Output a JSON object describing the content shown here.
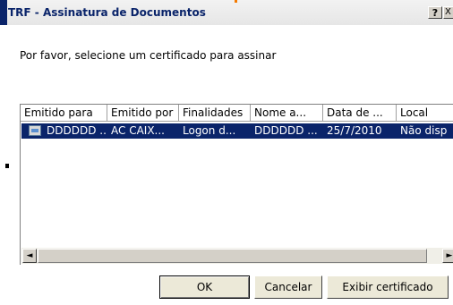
{
  "window": {
    "title": "TRF - Assinatura de Documentos",
    "help_label": "?",
    "close_label": "X"
  },
  "prompt": "Por favor, selecione um certificado para assinar",
  "table": {
    "columns": [
      "Emitido para",
      "Emitido por",
      "Finalidades",
      "Nome a...",
      "Data de ...",
      "Local"
    ],
    "rows": [
      {
        "icon": "certificate-icon",
        "cells": [
          "DDDDDD ..",
          "AC CAIX...",
          "Logon d...",
          "DDDDDD ...",
          "25/7/2010",
          "Não disp"
        ],
        "selected": true
      }
    ]
  },
  "scrollbar": {
    "left_arrow": "◄",
    "right_arrow": "►"
  },
  "buttons": {
    "ok": "OK",
    "cancel": "Cancelar",
    "view": "Exibir certificado"
  },
  "colors": {
    "selection": "#0a246a",
    "title": "#0a246a"
  }
}
